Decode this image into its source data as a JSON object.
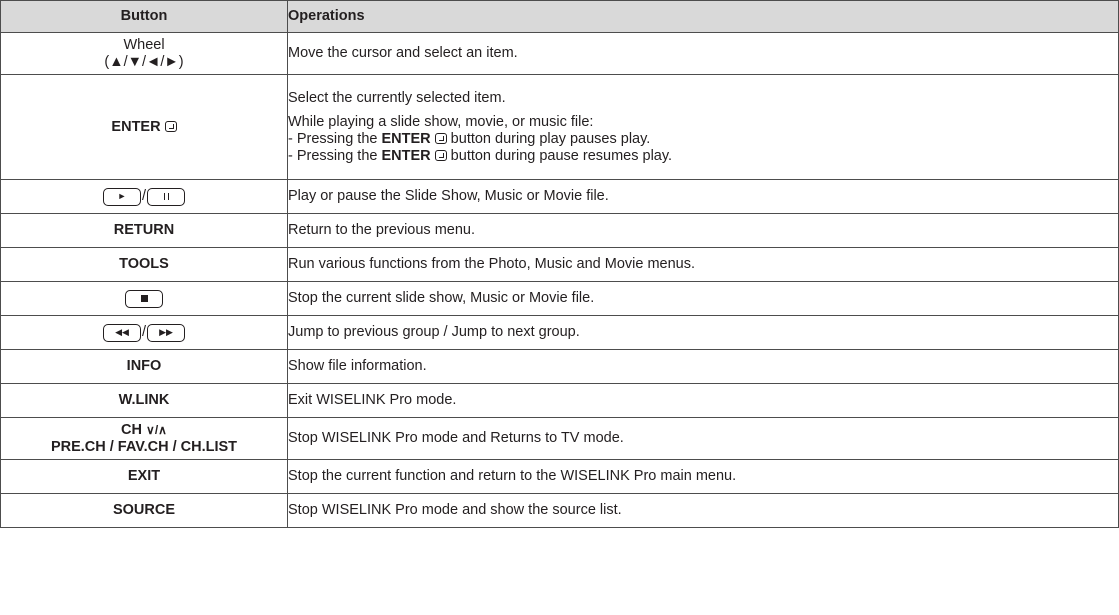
{
  "header": {
    "button": "Button",
    "operations": "Operations"
  },
  "rows": {
    "wheel": {
      "name": "Wheel",
      "arrows": "(▲/▼/◄/►)",
      "op": "Move the cursor and select an item."
    },
    "enter": {
      "name": "ENTER",
      "icon": "enter-icon",
      "op1": "Select the currently selected item.",
      "op2": "While playing a slide show, movie, or music file:",
      "op3_pre": "- Pressing the ",
      "op3_bold": "ENTER",
      "op3_post": " button during play pauses play.",
      "op4_pre": "- Pressing the ",
      "op4_bold": "ENTER",
      "op4_post": " button during pause resumes play."
    },
    "play_pause": {
      "sep": "/",
      "icons": [
        "play-key-icon",
        "pause-key-icon"
      ],
      "op": "Play or pause the Slide Show, Music or Movie file."
    },
    "return": {
      "name": "RETURN",
      "op": "Return to the previous menu."
    },
    "tools": {
      "name": "TOOLS",
      "op": "Run various functions from the Photo, Music and Movie menus."
    },
    "stop": {
      "icons": [
        "stop-key-icon"
      ],
      "op": "Stop the current slide show, Music or Movie file."
    },
    "skip": {
      "sep": "/",
      "icons": [
        "rewind-key-icon",
        "fast-forward-key-icon"
      ],
      "op": "Jump to previous group / Jump to next group."
    },
    "info": {
      "name": "INFO",
      "op": "Show file information."
    },
    "wlink": {
      "name": "W.LINK",
      "op": "Exit WISELINK Pro mode."
    },
    "ch": {
      "line1": "CH",
      "chevrons": "∨/∧",
      "line2": "PRE.CH / FAV.CH / CH.LIST",
      "op": "Stop WISELINK Pro mode and Returns to TV mode."
    },
    "exit": {
      "name": "EXIT",
      "op": "Stop the current function and return to the WISELINK Pro main menu."
    },
    "source": {
      "name": "SOURCE",
      "op": "Stop WISELINK Pro mode and show the source list."
    }
  },
  "colors": {
    "header_bg": "#d9d9d9",
    "border": "#4d4d4d",
    "text": "#231f20"
  }
}
